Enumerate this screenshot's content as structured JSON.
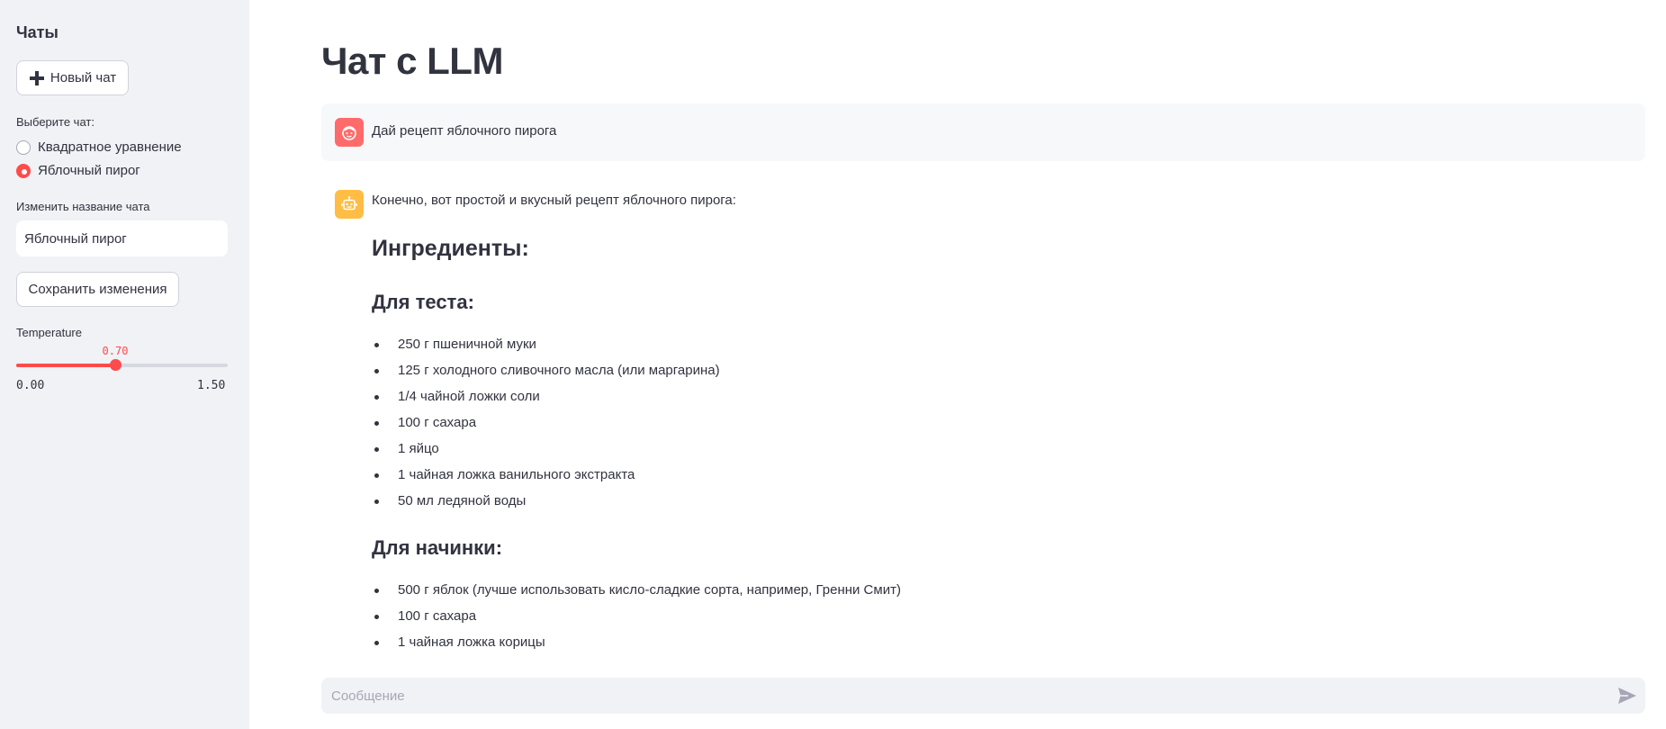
{
  "sidebar": {
    "title": "Чаты",
    "new_chat_label": "Новый чат",
    "select_label": "Выберите чат:",
    "chats": [
      {
        "label": "Квадратное уравнение",
        "selected": false
      },
      {
        "label": "Яблочный пирог",
        "selected": true
      }
    ],
    "rename_label": "Изменить название чата",
    "rename_value": "Яблочный пирог",
    "save_label": "Сохранить изменения",
    "temperature": {
      "label": "Temperature",
      "value": 0.7,
      "value_text": "0.70",
      "min": 0,
      "max": 1.5,
      "min_text": "0.00",
      "max_text": "1.50"
    }
  },
  "main": {
    "title": "Чат с LLM",
    "user_message": "Дай рецепт яблочного пирога",
    "assistant": {
      "intro": "Конечно, вот простой и вкусный рецепт яблочного пирога:",
      "heading": "Ингредиенты:",
      "sections": [
        {
          "title": "Для теста:",
          "items": [
            "250 г пшеничной муки",
            "125 г холодного сливочного масла (или маргарина)",
            "1/4 чайной ложки соли",
            "100 г сахара",
            "1 яйцо",
            "1 чайная ложка ванильного экстракта",
            "50 мл ледяной воды"
          ]
        },
        {
          "title": "Для начинки:",
          "items": [
            "500 г яблок (лучше использовать кисло-сладкие сорта, например, Гренни Смит)",
            "100 г сахара",
            "1 чайная ложка корицы"
          ]
        }
      ]
    },
    "input_placeholder": "Сообщение"
  },
  "colors": {
    "accent": "#ff4b4b",
    "sidebar_bg": "#f0f2f6",
    "user_avatar": "#ff6b6b",
    "bot_avatar": "#ffbd45",
    "text": "#31333f"
  },
  "icons": {
    "new_chat": "plus-icon",
    "user_avatar": "user-face-icon",
    "bot_avatar": "robot-icon",
    "send": "send-icon"
  }
}
